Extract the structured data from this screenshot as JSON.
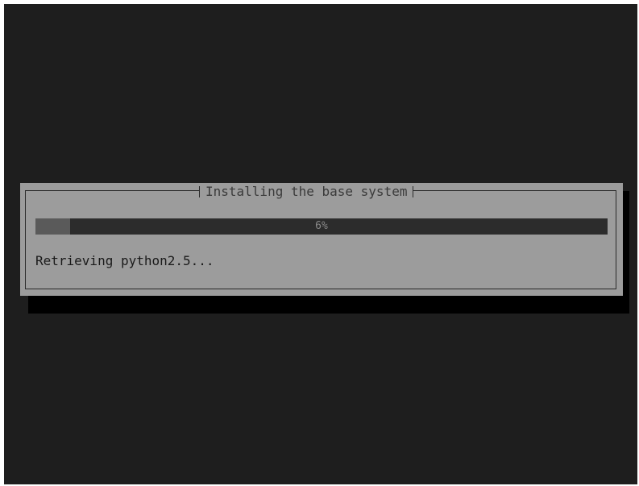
{
  "dialog": {
    "title": "Installing the base system",
    "progress": {
      "percent": 6,
      "label": "6%"
    },
    "status_text": "Retrieving python2.5..."
  },
  "colors": {
    "background": "#1e1e1e",
    "dialog": "#9c9c9c",
    "progress_track": "#2c2c2c",
    "progress_fill": "#5a5a5a"
  }
}
